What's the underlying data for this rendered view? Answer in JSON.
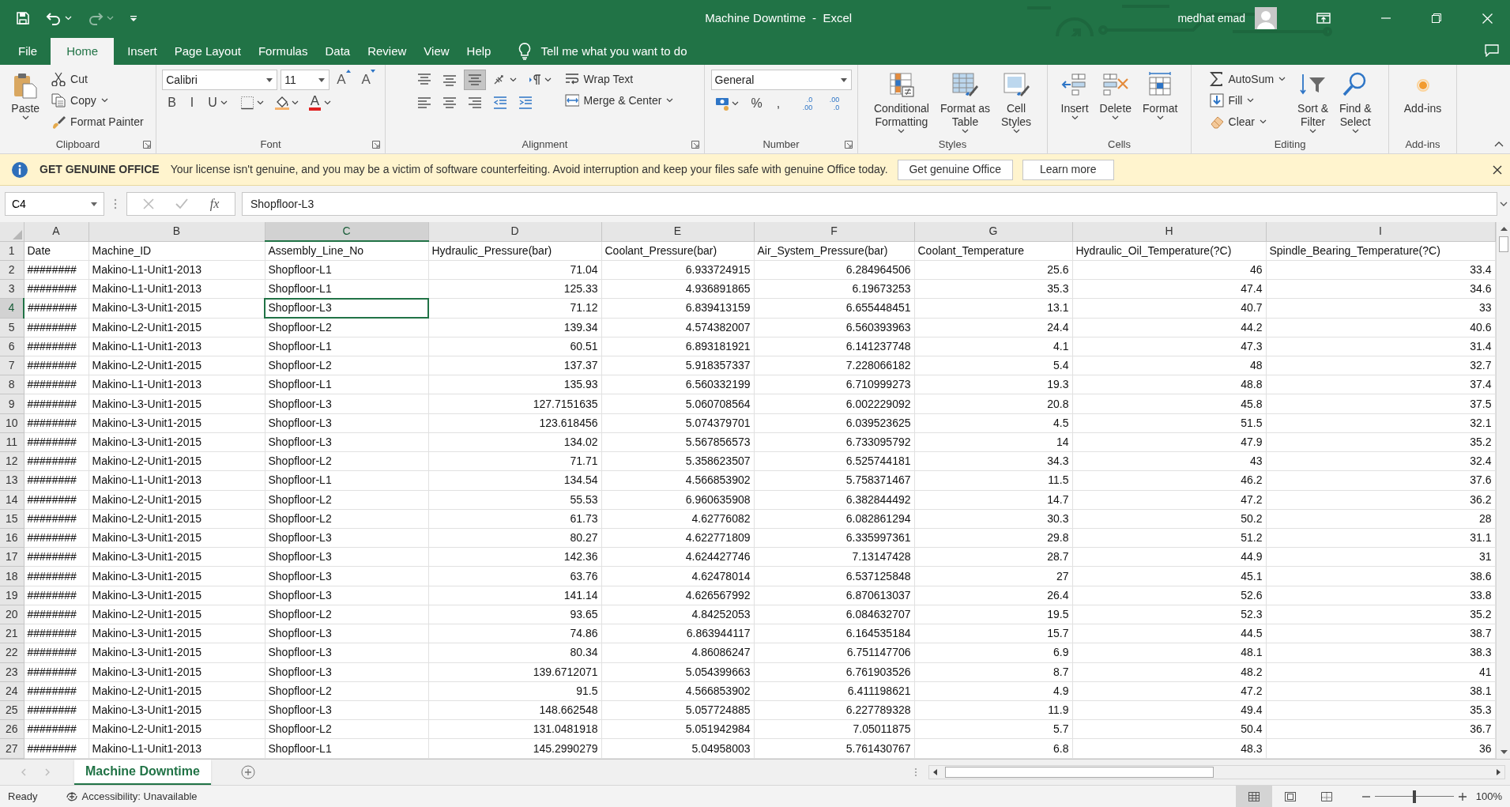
{
  "title_bar": {
    "title": "Machine Downtime  -  Excel",
    "user": "medhat emad"
  },
  "ribbon_tabs": [
    {
      "label": "File",
      "selected": false
    },
    {
      "label": "Home",
      "selected": true
    },
    {
      "label": "Insert",
      "selected": false
    },
    {
      "label": "Page Layout",
      "selected": false
    },
    {
      "label": "Formulas",
      "selected": false
    },
    {
      "label": "Data",
      "selected": false
    },
    {
      "label": "Review",
      "selected": false
    },
    {
      "label": "View",
      "selected": false
    },
    {
      "label": "Help",
      "selected": false
    }
  ],
  "tell_me": "Tell me what you want to do",
  "ribbon_groups": [
    {
      "label": "Clipboard",
      "launcher": true,
      "columns": [
        [
          [
            {
              "kind": "paste",
              "label": "Paste",
              "dropdown": true
            }
          ]
        ],
        [
          [
            {
              "kind": "cut",
              "label": "Cut",
              "dropdown": false
            }
          ],
          [
            {
              "kind": "copy",
              "label": "Copy",
              "dropdown": true
            }
          ],
          [
            {
              "kind": "painter",
              "label": "Format Painter",
              "dropdown": false
            }
          ]
        ]
      ]
    },
    {
      "label": "Font",
      "launcher": true,
      "columns": [
        [
          [
            {
              "kind": "fontbox",
              "value": "Calibri"
            },
            {
              "kind": "sizebox",
              "value": "11"
            },
            {
              "kind": "grow",
              "text": "A"
            },
            {
              "kind": "shrink",
              "text": "A"
            }
          ],
          [
            {
              "kind": "glyph",
              "text": "B",
              "dropdown": false
            },
            {
              "kind": "glyph",
              "text": "I",
              "dropdown": false
            },
            {
              "kind": "glyph",
              "text": "U",
              "dropdown": true
            },
            {
              "kind": "borders"
            },
            {
              "kind": "fill"
            },
            {
              "kind": "fontcolor",
              "text": "A"
            }
          ]
        ]
      ]
    },
    {
      "label": "Alignment",
      "launcher": true,
      "columns": [
        [
          [
            {
              "kind": "aligntop",
              "pressed": false
            },
            {
              "kind": "alignmiddle",
              "pressed": false
            },
            {
              "kind": "alignbottom",
              "pressed": true
            },
            {
              "kind": "orientation"
            },
            {
              "kind": "direction"
            }
          ],
          [
            {
              "kind": "alignleft",
              "pressed": false
            },
            {
              "kind": "aligncenter",
              "pressed": false
            },
            {
              "kind": "alignright",
              "pressed": false
            },
            {
              "kind": "outdent"
            },
            {
              "kind": "indent"
            }
          ]
        ],
        [
          [
            {
              "kind": "wrap",
              "label": "Wrap Text",
              "dropdown": false
            }
          ],
          [
            {
              "kind": "merge",
              "label": "Merge & Center",
              "dropdown": true
            }
          ]
        ]
      ]
    },
    {
      "label": "Number",
      "launcher": true,
      "columns": [
        [
          [
            {
              "kind": "formatbox",
              "value": "General"
            }
          ],
          [
            {
              "kind": "accounting"
            },
            {
              "kind": "glyph",
              "text": "%",
              "dropdown": false
            },
            {
              "kind": "glyph",
              "text": ",",
              "dropdown": false
            },
            {
              "kind": "decimals",
              "text": ".0\n.00"
            },
            {
              "kind": "decimals",
              "text": ".00\n.0"
            }
          ]
        ]
      ]
    },
    {
      "label": "Styles",
      "launcher": false,
      "columns": [
        [
          [
            {
              "kind": "conditional",
              "label": "Conditional\nFormatting",
              "dropdown": true
            }
          ]
        ],
        [
          [
            {
              "kind": "formattable",
              "label": "Format as\nTable",
              "dropdown": true
            }
          ]
        ],
        [
          [
            {
              "kind": "cellstyles",
              "label": "Cell\nStyles",
              "dropdown": true
            }
          ]
        ]
      ]
    },
    {
      "label": "Cells",
      "launcher": false,
      "columns": [
        [
          [
            {
              "kind": "insert",
              "label": "Insert",
              "dropdown": true
            }
          ]
        ],
        [
          [
            {
              "kind": "delete",
              "label": "Delete",
              "dropdown": true
            }
          ]
        ],
        [
          [
            {
              "kind": "format",
              "label": "Format",
              "dropdown": true
            }
          ]
        ]
      ]
    },
    {
      "label": "Editing",
      "launcher": false,
      "columns": [
        [
          [
            {
              "kind": "autosum",
              "label": "AutoSum",
              "dropdown": true
            }
          ],
          [
            {
              "kind": "fillsmall",
              "label": "Fill",
              "dropdown": true
            }
          ],
          [
            {
              "kind": "clear",
              "label": "Clear",
              "dropdown": true
            }
          ]
        ],
        [
          [
            {
              "kind": "sort",
              "label": "Sort &\nFilter",
              "dropdown": true
            }
          ]
        ],
        [
          [
            {
              "kind": "find",
              "label": "Find &\nSelect",
              "dropdown": true
            }
          ]
        ]
      ]
    },
    {
      "label": "Add-ins",
      "launcher": false,
      "columns": [
        [
          [
            {
              "kind": "addins",
              "label": "Add-ins",
              "dropdown": false
            }
          ]
        ]
      ]
    }
  ],
  "message_bar": {
    "heading": "GET GENUINE OFFICE",
    "text": "Your license isn't genuine, and you may be a victim of software counterfeiting. Avoid interruption and keep your files safe with genuine Office today.",
    "buttons": [
      "Get genuine Office",
      "Learn more"
    ]
  },
  "formula_bar": {
    "name_box": "C4",
    "function_label": "fx",
    "formula": "Shopfloor-L3"
  },
  "columns": [
    {
      "letter": "A",
      "numeric": false,
      "selected": false
    },
    {
      "letter": "B",
      "numeric": false,
      "selected": false
    },
    {
      "letter": "C",
      "numeric": false,
      "selected": true
    },
    {
      "letter": "D",
      "numeric": true,
      "selected": false
    },
    {
      "letter": "E",
      "numeric": true,
      "selected": false
    },
    {
      "letter": "F",
      "numeric": true,
      "selected": false
    },
    {
      "letter": "G",
      "numeric": true,
      "selected": false
    },
    {
      "letter": "H",
      "numeric": true,
      "selected": false
    },
    {
      "letter": "I",
      "numeric": true,
      "selected": false
    }
  ],
  "rows": [
    {
      "number": "1",
      "selected": false,
      "cells": [
        "Date",
        "Machine_ID",
        "Assembly_Line_No",
        "Hydraulic_Pressure(bar)",
        "Coolant_Pressure(bar)",
        "Air_System_Pressure(bar)",
        "Coolant_Temperature",
        "Hydraulic_Oil_Temperature(?C)",
        "Spindle_Bearing_Temperature(?C)"
      ]
    },
    {
      "number": "2",
      "selected": false,
      "cells": [
        "########",
        "Makino-L1-Unit1-2013",
        "Shopfloor-L1",
        "71.04",
        "6.933724915",
        "6.284964506",
        "25.6",
        "46",
        "33.4"
      ]
    },
    {
      "number": "3",
      "selected": false,
      "cells": [
        "########",
        "Makino-L1-Unit1-2013",
        "Shopfloor-L1",
        "125.33",
        "4.936891865",
        "6.19673253",
        "35.3",
        "47.4",
        "34.6"
      ]
    },
    {
      "number": "4",
      "selected": true,
      "cells": [
        "########",
        "Makino-L3-Unit1-2015",
        "Shopfloor-L3",
        "71.12",
        "6.839413159",
        "6.655448451",
        "13.1",
        "40.7",
        "33"
      ]
    },
    {
      "number": "5",
      "selected": false,
      "cells": [
        "########",
        "Makino-L2-Unit1-2015",
        "Shopfloor-L2",
        "139.34",
        "4.574382007",
        "6.560393963",
        "24.4",
        "44.2",
        "40.6"
      ]
    },
    {
      "number": "6",
      "selected": false,
      "cells": [
        "########",
        "Makino-L1-Unit1-2013",
        "Shopfloor-L1",
        "60.51",
        "6.893181921",
        "6.141237748",
        "4.1",
        "47.3",
        "31.4"
      ]
    },
    {
      "number": "7",
      "selected": false,
      "cells": [
        "########",
        "Makino-L2-Unit1-2015",
        "Shopfloor-L2",
        "137.37",
        "5.918357337",
        "7.228066182",
        "5.4",
        "48",
        "32.7"
      ]
    },
    {
      "number": "8",
      "selected": false,
      "cells": [
        "########",
        "Makino-L1-Unit1-2013",
        "Shopfloor-L1",
        "135.93",
        "6.560332199",
        "6.710999273",
        "19.3",
        "48.8",
        "37.4"
      ]
    },
    {
      "number": "9",
      "selected": false,
      "cells": [
        "########",
        "Makino-L3-Unit1-2015",
        "Shopfloor-L3",
        "127.7151635",
        "5.060708564",
        "6.002229092",
        "20.8",
        "45.8",
        "37.5"
      ]
    },
    {
      "number": "10",
      "selected": false,
      "cells": [
        "########",
        "Makino-L3-Unit1-2015",
        "Shopfloor-L3",
        "123.618456",
        "5.074379701",
        "6.039523625",
        "4.5",
        "51.5",
        "32.1"
      ]
    },
    {
      "number": "11",
      "selected": false,
      "cells": [
        "########",
        "Makino-L3-Unit1-2015",
        "Shopfloor-L3",
        "134.02",
        "5.567856573",
        "6.733095792",
        "14",
        "47.9",
        "35.2"
      ]
    },
    {
      "number": "12",
      "selected": false,
      "cells": [
        "########",
        "Makino-L2-Unit1-2015",
        "Shopfloor-L2",
        "71.71",
        "5.358623507",
        "6.525744181",
        "34.3",
        "43",
        "32.4"
      ]
    },
    {
      "number": "13",
      "selected": false,
      "cells": [
        "########",
        "Makino-L1-Unit1-2013",
        "Shopfloor-L1",
        "134.54",
        "4.566853902",
        "5.758371467",
        "11.5",
        "46.2",
        "37.6"
      ]
    },
    {
      "number": "14",
      "selected": false,
      "cells": [
        "########",
        "Makino-L2-Unit1-2015",
        "Shopfloor-L2",
        "55.53",
        "6.960635908",
        "6.382844492",
        "14.7",
        "47.2",
        "36.2"
      ]
    },
    {
      "number": "15",
      "selected": false,
      "cells": [
        "########",
        "Makino-L2-Unit1-2015",
        "Shopfloor-L2",
        "61.73",
        "4.62776082",
        "6.082861294",
        "30.3",
        "50.2",
        "28"
      ]
    },
    {
      "number": "16",
      "selected": false,
      "cells": [
        "########",
        "Makino-L3-Unit1-2015",
        "Shopfloor-L3",
        "80.27",
        "4.622771809",
        "6.335997361",
        "29.8",
        "51.2",
        "31.1"
      ]
    },
    {
      "number": "17",
      "selected": false,
      "cells": [
        "########",
        "Makino-L3-Unit1-2015",
        "Shopfloor-L3",
        "142.36",
        "4.624427746",
        "7.13147428",
        "28.7",
        "44.9",
        "31"
      ]
    },
    {
      "number": "18",
      "selected": false,
      "cells": [
        "########",
        "Makino-L3-Unit1-2015",
        "Shopfloor-L3",
        "63.76",
        "4.62478014",
        "6.537125848",
        "27",
        "45.1",
        "38.6"
      ]
    },
    {
      "number": "19",
      "selected": false,
      "cells": [
        "########",
        "Makino-L3-Unit1-2015",
        "Shopfloor-L3",
        "141.14",
        "4.626567992",
        "6.870613037",
        "26.4",
        "52.6",
        "33.8"
      ]
    },
    {
      "number": "20",
      "selected": false,
      "cells": [
        "########",
        "Makino-L2-Unit1-2015",
        "Shopfloor-L2",
        "93.65",
        "4.84252053",
        "6.084632707",
        "19.5",
        "52.3",
        "35.2"
      ]
    },
    {
      "number": "21",
      "selected": false,
      "cells": [
        "########",
        "Makino-L3-Unit1-2015",
        "Shopfloor-L3",
        "74.86",
        "6.863944117",
        "6.164535184",
        "15.7",
        "44.5",
        "38.7"
      ]
    },
    {
      "number": "22",
      "selected": false,
      "cells": [
        "########",
        "Makino-L3-Unit1-2015",
        "Shopfloor-L3",
        "80.34",
        "4.86086247",
        "6.751147706",
        "6.9",
        "48.1",
        "38.3"
      ]
    },
    {
      "number": "23",
      "selected": false,
      "cells": [
        "########",
        "Makino-L3-Unit1-2015",
        "Shopfloor-L3",
        "139.6712071",
        "5.054399663",
        "6.761903526",
        "8.7",
        "48.2",
        "41"
      ]
    },
    {
      "number": "24",
      "selected": false,
      "cells": [
        "########",
        "Makino-L2-Unit1-2015",
        "Shopfloor-L2",
        "91.5",
        "4.566853902",
        "6.411198621",
        "4.9",
        "47.2",
        "38.1"
      ]
    },
    {
      "number": "25",
      "selected": false,
      "cells": [
        "########",
        "Makino-L3-Unit1-2015",
        "Shopfloor-L3",
        "148.662548",
        "5.057724885",
        "6.227789328",
        "11.9",
        "49.4",
        "35.3"
      ]
    },
    {
      "number": "26",
      "selected": false,
      "cells": [
        "########",
        "Makino-L2-Unit1-2015",
        "Shopfloor-L2",
        "131.0481918",
        "5.051942984",
        "7.05011875",
        "5.7",
        "50.4",
        "36.7"
      ]
    },
    {
      "number": "27",
      "selected": false,
      "cells": [
        "########",
        "Makino-L1-Unit1-2013",
        "Shopfloor-L1",
        "145.2990279",
        "5.04958003",
        "5.761430767",
        "6.8",
        "48.3",
        "36"
      ]
    }
  ],
  "sheet_tabs": [
    {
      "label": "Machine Downtime",
      "selected": true
    }
  ],
  "status_bar": {
    "status": "Ready",
    "accessibility": "Accessibility: Unavailable",
    "views": [
      {
        "selected": true
      },
      {
        "selected": false
      },
      {
        "selected": false
      }
    ],
    "zoom": {
      "level": 0.5,
      "reading": "100%"
    }
  }
}
